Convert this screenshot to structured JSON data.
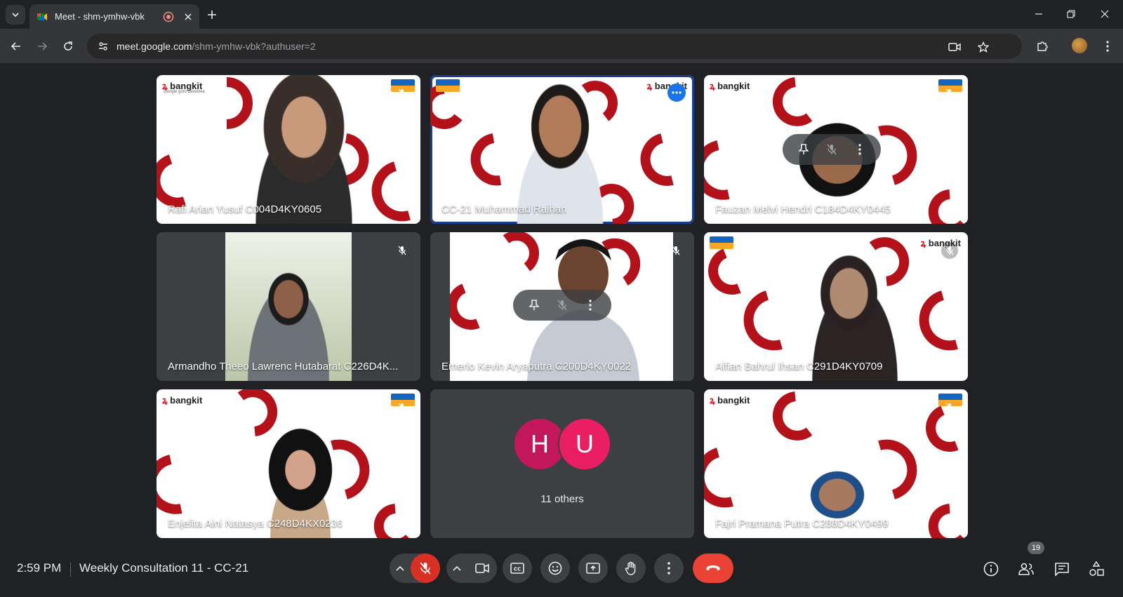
{
  "browser": {
    "tab_title": "Meet - shm-ymhw-vbk",
    "url_host": "meet.google.com",
    "url_path": "/shm-ymhw-vbk?authuser=2"
  },
  "participants": [
    {
      "name": "Rafi Arian Yusuf C004D4KY0605",
      "muted": true
    },
    {
      "name": "CC-21 Muhammad Raihan",
      "muted": false,
      "active_speaker": true
    },
    {
      "name": "Fauzan Melvi Hendri C184D4KY0445",
      "muted": true
    },
    {
      "name": "Armandho Theeo Lawrenc Hutabarat C226D4K...",
      "muted": true
    },
    {
      "name": "Emerio Kevin Aryaputra C200D4KY0022",
      "muted": true
    },
    {
      "name": "Alfian Bahrul Ihsan C291D4KY0709",
      "muted": true
    },
    {
      "name": "Enjelita Aini Natasya C248D4KX0236",
      "muted": true
    },
    {
      "name": "Fajri Pramana Putra C288D4KY0499",
      "muted": true
    }
  ],
  "logo": {
    "brand": "bangkit",
    "sub": "Google  goto  traveloka"
  },
  "others": {
    "avatars": [
      {
        "letter": "H",
        "color": "#c2185b"
      },
      {
        "letter": "U",
        "color": "#e91e63"
      }
    ],
    "label": "11 others"
  },
  "bottom": {
    "time": "2:59 PM",
    "meeting_title": "Weekly Consultation 11 - CC-21",
    "people_count": "19"
  },
  "colors": {
    "accent_blue": "#1a73e8",
    "hangup_red": "#ea4335",
    "mic_off_red": "#d93025",
    "pattern_red": "#b3121b"
  }
}
